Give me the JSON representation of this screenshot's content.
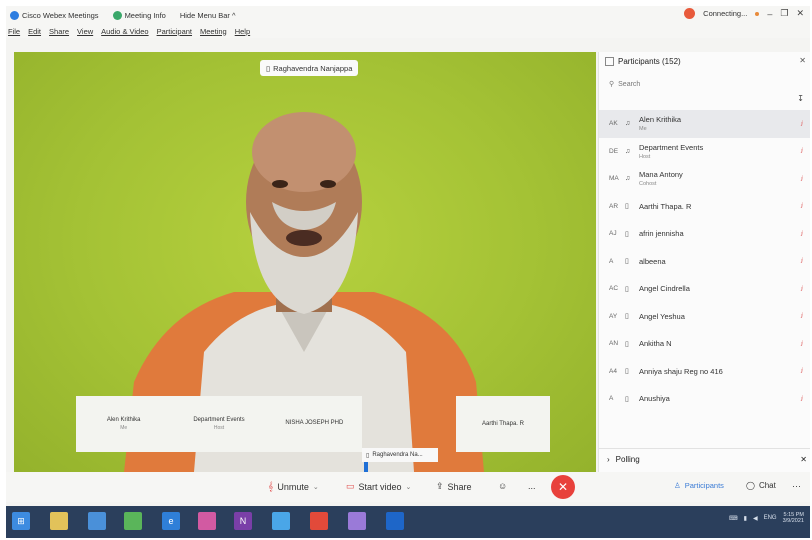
{
  "titlebar": {
    "app_name": "Cisco Webex Meetings",
    "meeting_info": "Meeting Info",
    "hide_menu": "Hide Menu Bar ^",
    "status": "Connecting..."
  },
  "menubar": [
    "File",
    "Edit",
    "Share",
    "View",
    "Audio & Video",
    "Participant",
    "Meeting",
    "Help"
  ],
  "video": {
    "active_speaker": "Raghavendra Nanjappa",
    "tiles": [
      {
        "name": "Alen Krithika",
        "sub": "Me"
      },
      {
        "name": "Department Events",
        "sub": "Host"
      },
      {
        "name": "NISHA JOSEPH PHD",
        "sub": ""
      }
    ],
    "tile_single": "Aarthi Thapa. R",
    "self_view_label": "Raghavendra Na..."
  },
  "controls": {
    "unmute": "Unmute",
    "start_video": "Start video",
    "share": "Share",
    "more": "...",
    "participants": "Participants",
    "chat": "Chat",
    "overflow": "···"
  },
  "panel": {
    "title": "Participants (152)",
    "search_placeholder": "Search",
    "participants": [
      {
        "initials": "AK",
        "name": "Alen Krithika",
        "role": "Me"
      },
      {
        "initials": "DE",
        "name": "Department Events",
        "role": "Host"
      },
      {
        "initials": "MA",
        "name": "Mana Antony",
        "role": "Cohost"
      },
      {
        "initials": "AR",
        "name": "Aarthi Thapa. R",
        "role": ""
      },
      {
        "initials": "AJ",
        "name": "afrin jennisha",
        "role": ""
      },
      {
        "initials": "A",
        "name": "albeena",
        "role": ""
      },
      {
        "initials": "AC",
        "name": "Angel Cindrella",
        "role": ""
      },
      {
        "initials": "AY",
        "name": "Angel Yeshua",
        "role": ""
      },
      {
        "initials": "AN",
        "name": "Ankitha N",
        "role": ""
      },
      {
        "initials": "A4",
        "name": "Anniya shaju Reg no 416",
        "role": ""
      },
      {
        "initials": "A",
        "name": "Anushiya",
        "role": ""
      }
    ],
    "polling": "Polling"
  },
  "taskbar": {
    "tray_lang": "ENG",
    "time": "5:15 PM",
    "date": "3/9/2021"
  },
  "colors": {
    "video_bg": "#a3c434",
    "end_call": "#e8413b",
    "taskbar": "#2b3f5c"
  }
}
